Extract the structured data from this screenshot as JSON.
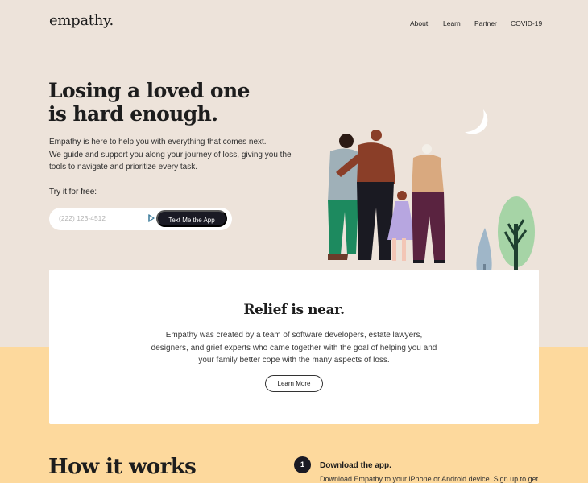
{
  "brand": {
    "logo": "empathy."
  },
  "nav": {
    "items": [
      "About",
      "Learn",
      "Partner",
      "COVID-19"
    ]
  },
  "hero": {
    "title_lines": [
      "Losing a loved one",
      "is hard enough."
    ],
    "description_lines": [
      "Empathy is here to help you with everything that comes next.",
      "We guide and support you along your journey of loss, giving you the",
      "tools to navigate and prioritize every task."
    ],
    "try_label": "Try it for free:",
    "phone_placeholder": "(222) 123-4512",
    "cta_label": "Text Me the App"
  },
  "relief": {
    "title": "Relief is near.",
    "text_lines": [
      "Empathy was created by a team of software developers, estate lawyers,",
      "designers, and grief experts who came together with the goal of helping you and",
      "your family better cope with the many aspects of loss."
    ],
    "button_label": "Learn More"
  },
  "how": {
    "title": "How it works",
    "steps": [
      {
        "number": "1",
        "title": "Download the app.",
        "description": "Download Empathy to your iPhone or Android device. Sign up to get"
      }
    ]
  },
  "colors": {
    "background_top": "#ede3da",
    "background_bottom": "#fdd99d",
    "button_dark": "#1a1a24",
    "card": "#ffffff"
  },
  "icons": {
    "send": "send-arrow-icon",
    "moon": "crescent-moon-icon"
  }
}
